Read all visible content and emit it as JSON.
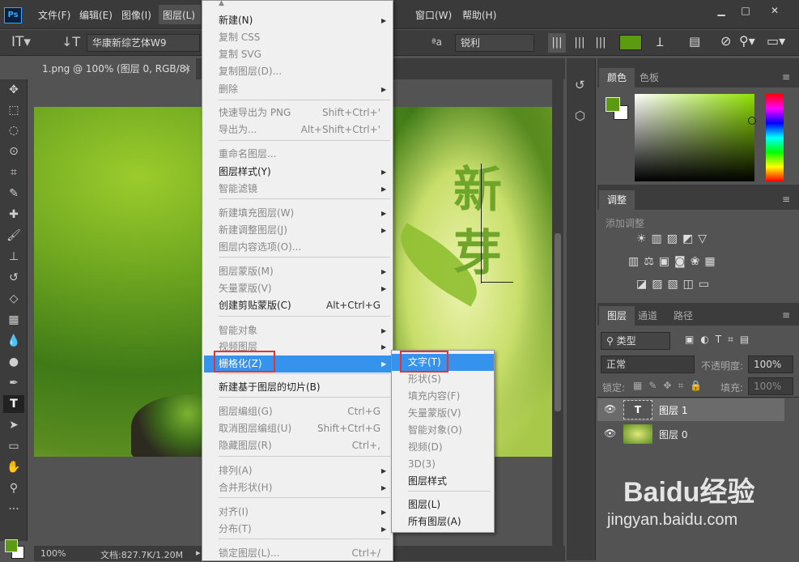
{
  "app": {
    "logo": "Ps"
  },
  "menubar": {
    "items": [
      "文件(F)",
      "编辑(E)",
      "图像(I)",
      "图层(L)",
      "窗口(W)",
      "帮助(H)"
    ]
  },
  "options": {
    "font_family": "华康新综艺体W9",
    "aa_icon": "ªa",
    "aa_mode": "锐利"
  },
  "document": {
    "tab_title": "1.png @ 100% (图层 0, RGB/8)",
    "canvas_text_1": "新",
    "canvas_text_2": "芽",
    "zoom": "100%",
    "doc_size": "文档:827.7K/1.20M"
  },
  "layer_menu": {
    "items": [
      {
        "label": "新建(N)",
        "shortcut": "",
        "submenu": true,
        "disabled": false
      },
      {
        "label": "复制 CSS",
        "shortcut": "",
        "submenu": false,
        "disabled": true
      },
      {
        "label": "复制 SVG",
        "shortcut": "",
        "submenu": false,
        "disabled": true
      },
      {
        "label": "复制图层(D)...",
        "shortcut": "",
        "submenu": false,
        "disabled": true
      },
      {
        "label": "删除",
        "shortcut": "",
        "submenu": true,
        "disabled": true
      },
      {
        "label": "快速导出为 PNG",
        "shortcut": "Shift+Ctrl+'",
        "submenu": false,
        "disabled": true
      },
      {
        "label": "导出为...",
        "shortcut": "Alt+Shift+Ctrl+'",
        "submenu": false,
        "disabled": true
      },
      {
        "label": "重命名图层...",
        "shortcut": "",
        "submenu": false,
        "disabled": true
      },
      {
        "label": "图层样式(Y)",
        "shortcut": "",
        "submenu": true,
        "disabled": false
      },
      {
        "label": "智能滤镜",
        "shortcut": "",
        "submenu": true,
        "disabled": true
      },
      {
        "label": "新建填充图层(W)",
        "shortcut": "",
        "submenu": true,
        "disabled": true
      },
      {
        "label": "新建调整图层(J)",
        "shortcut": "",
        "submenu": true,
        "disabled": true
      },
      {
        "label": "图层内容选项(O)...",
        "shortcut": "",
        "submenu": false,
        "disabled": true
      },
      {
        "label": "图层蒙版(M)",
        "shortcut": "",
        "submenu": true,
        "disabled": true
      },
      {
        "label": "矢量蒙版(V)",
        "shortcut": "",
        "submenu": true,
        "disabled": true
      },
      {
        "label": "创建剪贴蒙版(C)",
        "shortcut": "Alt+Ctrl+G",
        "submenu": false,
        "disabled": false
      },
      {
        "label": "智能对象",
        "shortcut": "",
        "submenu": true,
        "disabled": true
      },
      {
        "label": "视频图层",
        "shortcut": "",
        "submenu": true,
        "disabled": true
      },
      {
        "label": "栅格化(Z)",
        "shortcut": "",
        "submenu": true,
        "disabled": false
      },
      {
        "label": "新建基于图层的切片(B)",
        "shortcut": "",
        "submenu": false,
        "disabled": false
      },
      {
        "label": "图层编组(G)",
        "shortcut": "Ctrl+G",
        "submenu": false,
        "disabled": true
      },
      {
        "label": "取消图层编组(U)",
        "shortcut": "Shift+Ctrl+G",
        "submenu": false,
        "disabled": true
      },
      {
        "label": "隐藏图层(R)",
        "shortcut": "Ctrl+,",
        "submenu": false,
        "disabled": true
      },
      {
        "label": "排列(A)",
        "shortcut": "",
        "submenu": true,
        "disabled": true
      },
      {
        "label": "合并形状(H)",
        "shortcut": "",
        "submenu": true,
        "disabled": true
      },
      {
        "label": "对齐(I)",
        "shortcut": "",
        "submenu": true,
        "disabled": true
      },
      {
        "label": "分布(T)",
        "shortcut": "",
        "submenu": true,
        "disabled": true
      },
      {
        "label": "锁定图层(L)...",
        "shortcut": "Ctrl+/",
        "submenu": false,
        "disabled": true
      }
    ]
  },
  "raster_submenu": {
    "items": [
      {
        "label": "文字(T)",
        "disabled": false
      },
      {
        "label": "形状(S)",
        "disabled": true
      },
      {
        "label": "填充内容(F)",
        "disabled": true
      },
      {
        "label": "矢量蒙版(V)",
        "disabled": true
      },
      {
        "label": "智能对象(O)",
        "disabled": true
      },
      {
        "label": "视频(D)",
        "disabled": true
      },
      {
        "label": "3D(3)",
        "disabled": true
      },
      {
        "label": "图层样式",
        "disabled": false
      },
      {
        "label": "图层(L)",
        "disabled": false
      },
      {
        "label": "所有图层(A)",
        "disabled": false
      }
    ]
  },
  "panels": {
    "color_tab": "颜色",
    "swatches_tab": "色板",
    "adjust_tab": "调整",
    "adjust_hint": "添加调整",
    "layers_tab": "图层",
    "channels_tab": "通道",
    "paths_tab": "路径",
    "filter_kind": "类型",
    "blend_mode": "正常",
    "opacity_label": "不透明度:",
    "opacity_value": "100%",
    "lock_label": "锁定:",
    "fill_label": "填充:",
    "fill_value": "100%",
    "layers": [
      {
        "name": "图层 1",
        "type": "text"
      },
      {
        "name": "图层 0",
        "type": "image"
      }
    ]
  },
  "colors": {
    "foreground": "#5c9a12",
    "accent_highlight": "#3593ee",
    "callout": "#e53333"
  },
  "watermark": {
    "brand": "Baidu经验",
    "url": "jingyan.baidu.com"
  }
}
